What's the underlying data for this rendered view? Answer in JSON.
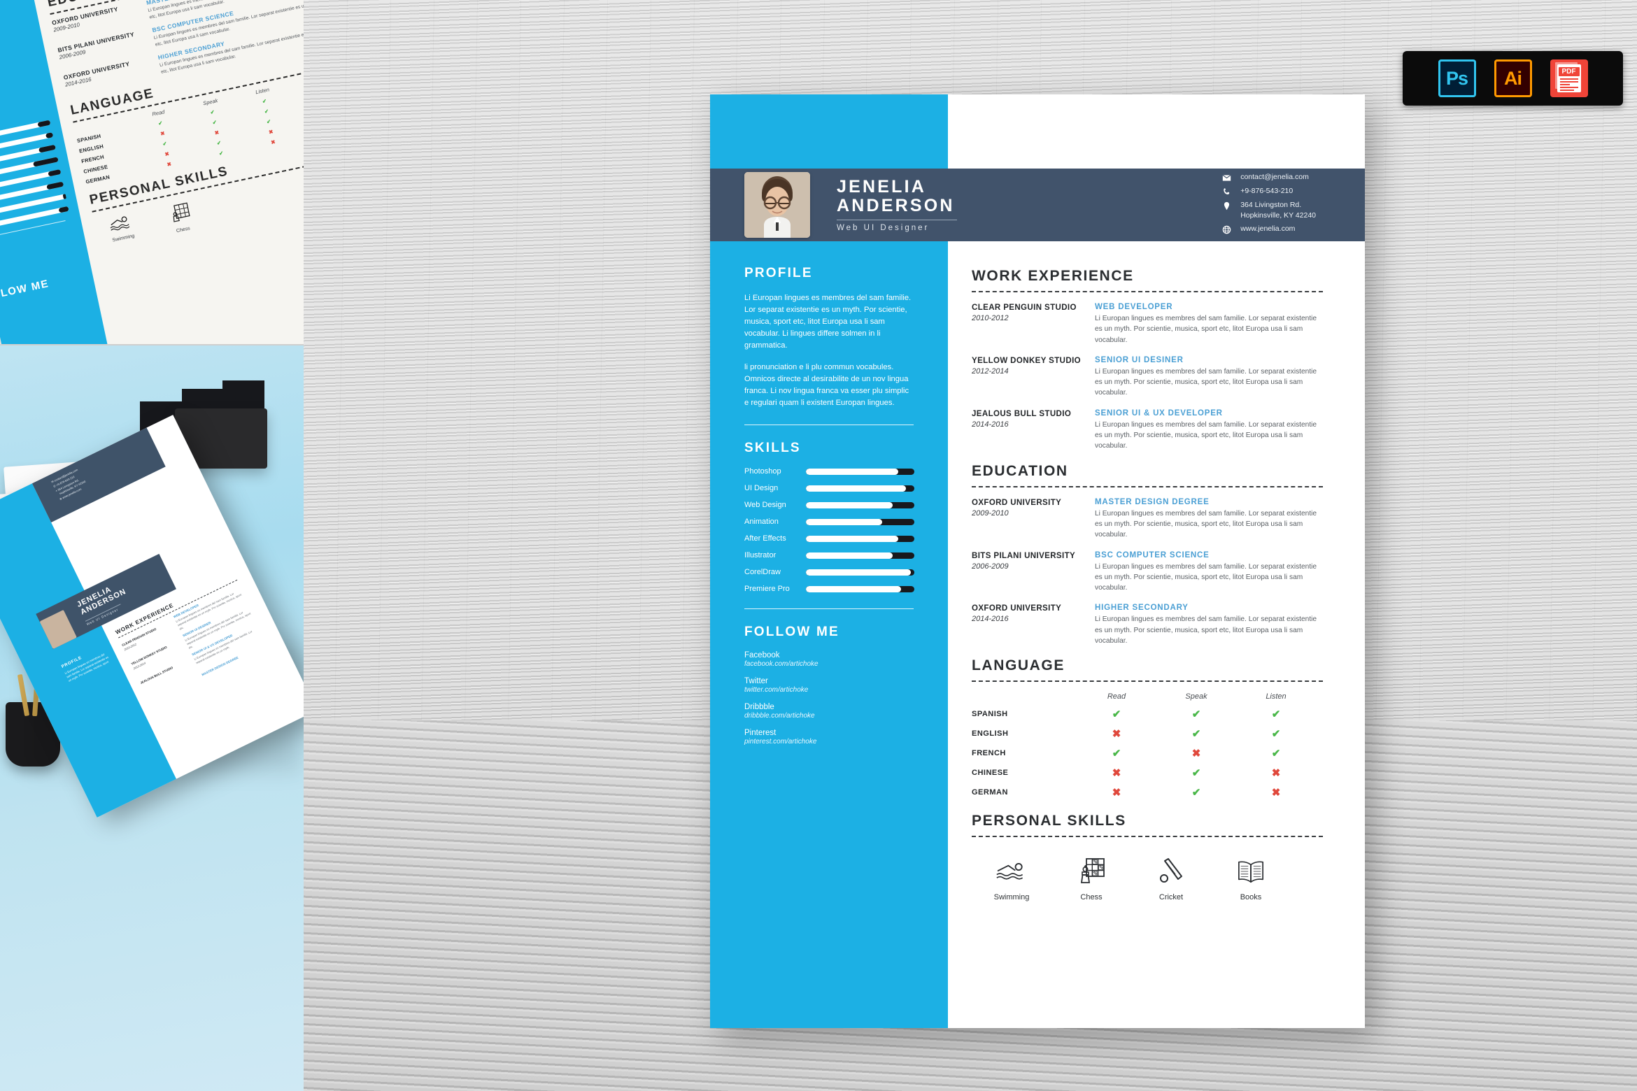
{
  "badges": {
    "items": [
      {
        "id": "photoshop",
        "label": "Ps"
      },
      {
        "id": "illustrator",
        "label": "Ai"
      },
      {
        "id": "pdf",
        "label": "PDF"
      }
    ]
  },
  "resume": {
    "header": {
      "first_name": "JENELIA",
      "last_name": "ANDERSON",
      "role": "Web UI Designer",
      "contact": [
        {
          "icon": "envelope-icon",
          "text": "contact@jenelia.com"
        },
        {
          "icon": "phone-icon",
          "text": "+9-876-543-210"
        },
        {
          "icon": "location-pin-icon",
          "text": "364 Livingston Rd.\nHopkinsville, KY 42240"
        },
        {
          "icon": "globe-icon",
          "text": "www.jenelia.com"
        }
      ]
    },
    "profile": {
      "title": "PROFILE",
      "paragraphs": [
        "Li Europan lingues es membres del sam familie. Lor separat existentie es un myth. Por scientie, musica, sport etc, litot Europa usa li sam vocabular. Li lingues differe solmen in li grammatica.",
        "li pronunciation e li plu commun vocabules. Omnicos directe al desirabilite de un nov lingua franca. Li nov lingua franca va esser plu simplic e regulari quam li existent Europan lingues."
      ]
    },
    "skills": {
      "title": "SKILLS",
      "items": [
        {
          "label": "Photoshop",
          "value": 85
        },
        {
          "label": "UI Design",
          "value": 92
        },
        {
          "label": "Web Design",
          "value": 80
        },
        {
          "label": "Animation",
          "value": 70
        },
        {
          "label": "After Effects",
          "value": 85
        },
        {
          "label": "Illustrator",
          "value": 80
        },
        {
          "label": "CorelDraw",
          "value": 97
        },
        {
          "label": "Premiere Pro",
          "value": 88
        }
      ]
    },
    "follow": {
      "title": "FOLLOW ME",
      "items": [
        {
          "name": "Facebook",
          "url": "facebook.com/artichoke"
        },
        {
          "name": "Twitter",
          "url": "twitter.com/artichoke"
        },
        {
          "name": "Dribbble",
          "url": "dribbble.com/artichoke"
        },
        {
          "name": "Pinterest",
          "url": "pinterest.com/artichoke"
        }
      ]
    },
    "work": {
      "title": "WORK EXPERIENCE",
      "entries": [
        {
          "org": "CLEAR PENGUIN STUDIO",
          "years": "2010-2012",
          "role": "WEB DEVELOPER",
          "desc": "Li Europan lingues es membres del sam familie. Lor separat existentie es un myth. Por scientie, musica, sport etc, litot Europa usa li sam vocabular."
        },
        {
          "org": "YELLOW DONKEY STUDIO",
          "years": "2012-2014",
          "role": "SENIOR UI DESINER",
          "desc": "Li Europan lingues es membres del sam familie. Lor separat existentie es un myth. Por scientie, musica, sport etc, litot Europa usa li sam vocabular."
        },
        {
          "org": "JEALOUS BULL STUDIO",
          "years": "2014-2016",
          "role": "SENIOR UI & UX DEVELOPER",
          "desc": "Li Europan lingues es membres del sam familie. Lor separat existentie es un myth. Por scientie, musica, sport etc, litot Europa usa li sam vocabular."
        }
      ]
    },
    "education": {
      "title": "EDUCATION",
      "entries": [
        {
          "org": "OXFORD UNIVERSITY",
          "years": "2009-2010",
          "role": "MASTER DESIGN DEGREE",
          "desc": "Li Europan lingues es membres del sam familie. Lor separat existentie es un myth. Por scientie, musica, sport etc, litot Europa usa li sam vocabular."
        },
        {
          "org": "BITS PILANI UNIVERSITY",
          "years": "2006-2009",
          "role": "BSC COMPUTER SCIENCE",
          "desc": "Li Europan lingues es membres del sam familie. Lor separat existentie es un myth. Por scientie, musica, sport etc, litot Europa usa li sam vocabular."
        },
        {
          "org": "OXFORD UNIVERSITY",
          "years": "2014-2016",
          "role": "HIGHER SECONDARY",
          "desc": "Li Europan lingues es membres del sam familie. Lor separat existentie es un myth. Por scientie, musica, sport etc, litot Europa usa li sam vocabular."
        }
      ]
    },
    "language": {
      "title": "LANGUAGE",
      "columns": [
        "Read",
        "Speak",
        "Listen"
      ],
      "rows": [
        {
          "name": "SPANISH",
          "read": true,
          "speak": true,
          "listen": true
        },
        {
          "name": "ENGLISH",
          "read": false,
          "speak": true,
          "listen": true
        },
        {
          "name": "FRENCH",
          "read": true,
          "speak": false,
          "listen": true
        },
        {
          "name": "CHINESE",
          "read": false,
          "speak": true,
          "listen": false
        },
        {
          "name": "GERMAN",
          "read": false,
          "speak": true,
          "listen": false
        }
      ],
      "yes_glyph": "✔",
      "no_glyph": "✖"
    },
    "personal_skills": {
      "title": "PERSONAL SKILLS",
      "items": [
        {
          "icon": "swimming-icon",
          "label": "Swimming"
        },
        {
          "icon": "chess-icon",
          "label": "Chess"
        },
        {
          "icon": "cricket-icon",
          "label": "Cricket"
        },
        {
          "icon": "books-icon",
          "label": "Books"
        }
      ]
    }
  },
  "colors": {
    "accent_cyan": "#1CB0E4",
    "header_navy": "#41536B",
    "role_blue": "#4A9FD4",
    "check_green": "#49B748",
    "cross_red": "#E0483C",
    "bar_dark": "#18191D"
  }
}
